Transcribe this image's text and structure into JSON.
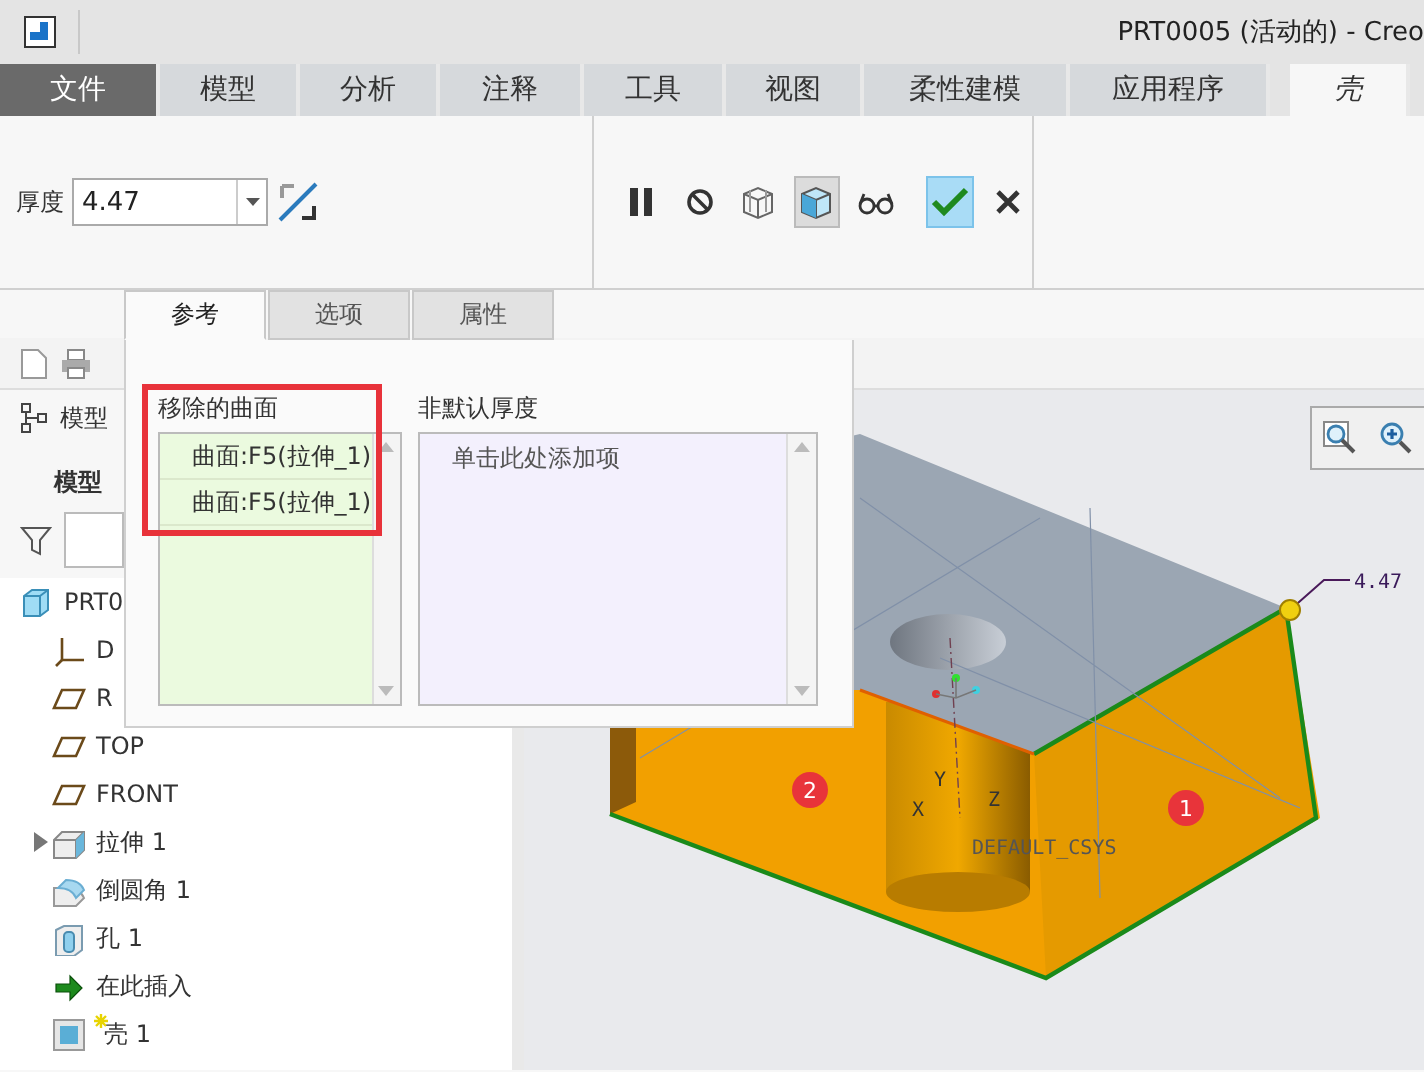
{
  "title_bar": {
    "title": "PRT0005 (活动的) - Creo"
  },
  "ribbon_tabs": [
    {
      "label": "文件",
      "kind": "file",
      "selected": false
    },
    {
      "label": "模型",
      "kind": "tab",
      "selected": false
    },
    {
      "label": "分析",
      "kind": "tab",
      "selected": false
    },
    {
      "label": "注释",
      "kind": "tab",
      "selected": false
    },
    {
      "label": "工具",
      "kind": "tab",
      "selected": false
    },
    {
      "label": "视图",
      "kind": "tab",
      "selected": false
    },
    {
      "label": "柔性建模",
      "kind": "tab",
      "selected": false
    },
    {
      "label": "应用程序",
      "kind": "tab",
      "selected": false
    },
    {
      "label": "壳",
      "kind": "tab",
      "selected": true
    }
  ],
  "ribbon": {
    "thickness_label": "厚度",
    "thickness_value": "4.47",
    "tools": [
      {
        "kind": "pause",
        "on": false
      },
      {
        "kind": "stop",
        "on": false
      },
      {
        "kind": "mesh-preview",
        "on": false
      },
      {
        "kind": "solid-preview",
        "on": true
      },
      {
        "kind": "glasses",
        "on": false
      },
      {
        "kind": "ok",
        "on": true
      },
      {
        "kind": "cancel",
        "on": false
      }
    ]
  },
  "model_tree": {
    "header": "模型",
    "title": "模型",
    "items": [
      {
        "label": "PRT0",
        "kind": "part",
        "children": [
          {
            "label": "D",
            "kind": "csys"
          },
          {
            "label": "R",
            "kind": "plane"
          },
          {
            "label": "TOP",
            "kind": "plane"
          },
          {
            "label": "FRONT",
            "kind": "plane"
          },
          {
            "label": "拉伸 1",
            "kind": "extrude",
            "expanded": false
          },
          {
            "label": "倒圆角 1",
            "kind": "round"
          },
          {
            "label": "孔 1",
            "kind": "hole"
          },
          {
            "label": "在此插入",
            "kind": "insert"
          },
          {
            "label": "壳 1",
            "kind": "shell",
            "new": true
          }
        ]
      }
    ]
  },
  "panel": {
    "tabs": [
      {
        "label": "参考",
        "selected": true
      },
      {
        "label": "选项",
        "selected": false
      },
      {
        "label": "属性",
        "selected": false
      }
    ],
    "removed_surfaces": {
      "label": "移除的曲面",
      "items": [
        "曲面:F5(拉伸_1)",
        "曲面:F5(拉伸_1)"
      ],
      "highlighted": true
    },
    "non_default_thickness": {
      "label": "非默认厚度",
      "placeholder": "单击此处添加项"
    }
  },
  "viewport": {
    "dimension": "4.47",
    "csys_label": "DEFAULT_CSYS",
    "axis_labels": [
      "X",
      "Y",
      "Z"
    ],
    "callouts": [
      "2",
      "1"
    ]
  }
}
